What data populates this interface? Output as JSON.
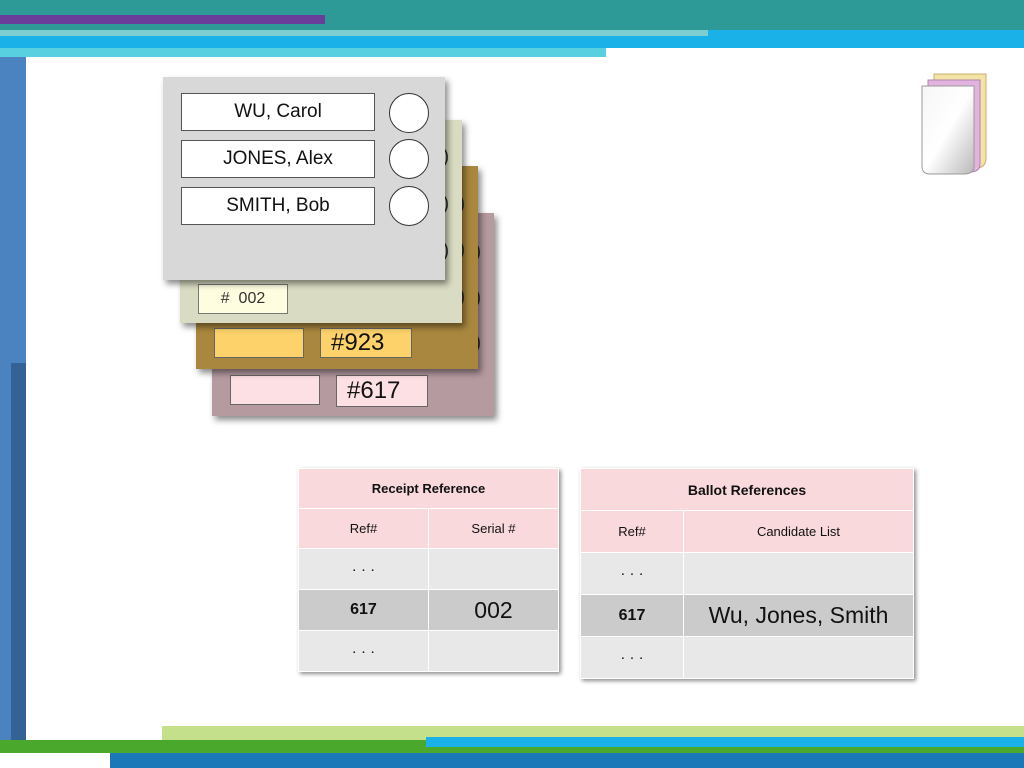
{
  "colors": {
    "top_purple": "#6a3d9a",
    "top_teal": "#2e9a97",
    "top_blue": "#1ab0e8",
    "top_cyan": "#58d0e0",
    "left_blue": "#4a83c0",
    "left_dark_blue": "#346296",
    "bottom_green": "#4aa82c",
    "bottom_lightgreen": "#c4e08a",
    "bottom_blue": "#1a77b8",
    "card_gray": "#d8d8d8",
    "card_sage": "#d9dcc3",
    "card_gold": "#a9873e",
    "card_mauve": "#b59aa0",
    "table_header_pink": "#f9d9dc"
  },
  "ballot": {
    "candidates": [
      "WU, Carol",
      "JONES, Alex",
      "SMITH, Bob"
    ],
    "card2_serial": "#  002",
    "card3_serial": "#923",
    "card4_serial": "#617"
  },
  "receipt_table": {
    "title": "Receipt Reference",
    "columns": [
      "Ref#",
      "Serial #"
    ],
    "rows": [
      [
        "· · ·",
        ""
      ],
      [
        "617",
        "002"
      ],
      [
        "· · ·",
        ""
      ]
    ]
  },
  "ballot_table": {
    "title": "Ballot References",
    "columns": [
      "Ref#",
      "Candidate List"
    ],
    "rows": [
      [
        "· · ·",
        ""
      ],
      [
        "617",
        "Wu, Jones, Smith"
      ],
      [
        "· · ·",
        ""
      ]
    ]
  },
  "icons": {
    "top_right": "stacked-pages-icon"
  }
}
